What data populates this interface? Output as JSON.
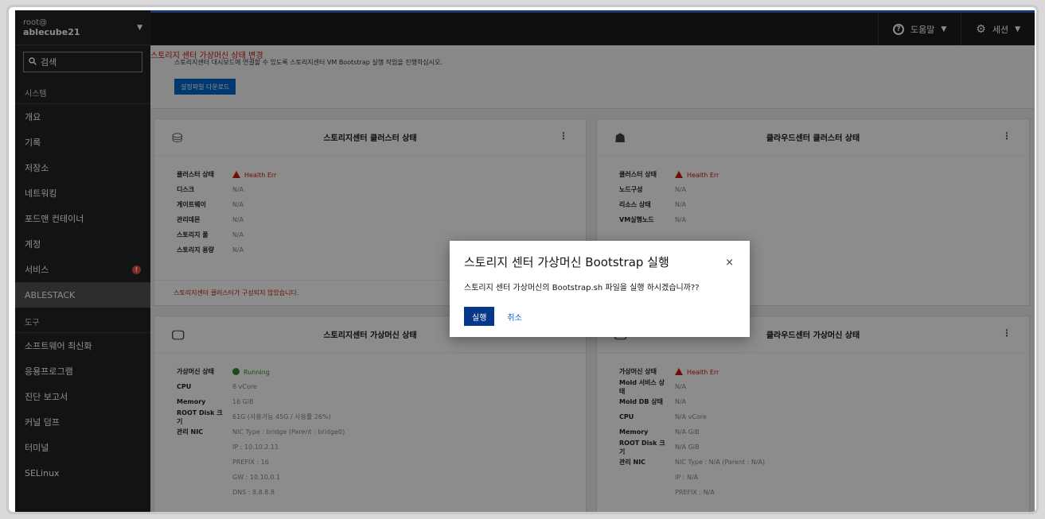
{
  "sidebar": {
    "user_line1": "root@",
    "user_line2": "ablecube21",
    "search_label": "검색",
    "items": [
      {
        "label": "시스템",
        "type": "section"
      },
      {
        "label": "개요"
      },
      {
        "label": "기록"
      },
      {
        "label": "저장소"
      },
      {
        "label": "네트워킹"
      },
      {
        "label": "포드맨 컨테이너"
      },
      {
        "label": "계정"
      },
      {
        "label": "서비스",
        "alert": "!"
      },
      {
        "label": "ABLESTACK",
        "active": true
      },
      {
        "label": "도구",
        "type": "section"
      },
      {
        "label": "소프트웨어 최신화"
      },
      {
        "label": "응용프로그램"
      },
      {
        "label": "진단 보고서"
      },
      {
        "label": "커널 덤프"
      },
      {
        "label": "터미널"
      },
      {
        "label": "SELinux"
      }
    ]
  },
  "topbar": {
    "help_label": "도움말",
    "session_label": "세션"
  },
  "banner": {
    "title": "스토리지 센터 가상머신 상태 변경",
    "desc": "스토리지센터 대시보드에 연결할 수 있도록 스토리지센터 VM Bootstrap 실행 작업을 진행하십시오.",
    "button": "설정파일 다운로드"
  },
  "cards": {
    "storage_cluster": {
      "title": "스토리지센터 클러스터 상태",
      "rows": [
        {
          "k": "클러스터 상태",
          "v": "Health Err"
        },
        {
          "k": "디스크",
          "v": "N/A"
        },
        {
          "k": "게이트웨이",
          "v": "N/A"
        },
        {
          "k": "관리데몬",
          "v": "N/A"
        },
        {
          "k": "스토리지 풀",
          "v": "N/A"
        },
        {
          "k": "스토리지 용량",
          "v": "N/A"
        }
      ],
      "footer": "스토리지센터 클러스터가 구성되지 않았습니다."
    },
    "cloud_cluster": {
      "title": "클라우드센터 클러스터 상태",
      "rows": [
        {
          "k": "클러스터 상태",
          "v": "Health Err"
        },
        {
          "k": "노드구성",
          "v": "N/A"
        },
        {
          "k": "리소스 상태",
          "v": "N/A"
        },
        {
          "k": "VM실행노드",
          "v": "N/A"
        }
      ]
    },
    "storage_vm": {
      "title": "스토리지센터 가상머신 상태",
      "rows": [
        {
          "k": "가상머신 상태",
          "v": "Running"
        },
        {
          "k": "CPU",
          "v": "8 vCore"
        },
        {
          "k": "Memory",
          "v": "16 GiB"
        },
        {
          "k": "ROOT Disk 크기",
          "v": "61G (사용가능 45G / 사용률 26%)"
        },
        {
          "k": "관리 NIC",
          "v": "NIC Type : bridge (Parent : bridge0)"
        },
        {
          "k": "",
          "v": "IP : 10.10.2.11"
        },
        {
          "k": "",
          "v": "PREFIX : 16"
        },
        {
          "k": "",
          "v": "GW : 10.10.0.1"
        },
        {
          "k": "",
          "v": "DNS : 8.8.8.8"
        }
      ]
    },
    "cloud_vm": {
      "title": "클라우드센터 가상머신 상태",
      "rows": [
        {
          "k": "가상머신 상태",
          "v": "Health Err"
        },
        {
          "k": "Mold 서비스 상태",
          "v": "N/A"
        },
        {
          "k": "Mold DB 상태",
          "v": "N/A"
        },
        {
          "k": "CPU",
          "v": "N/A vCore"
        },
        {
          "k": "Memory",
          "v": "N/A GiB"
        },
        {
          "k": "ROOT Disk 크기",
          "v": "N/A GiB"
        },
        {
          "k": "관리 NIC",
          "v": "NIC Type : N/A (Parent : N/A)"
        },
        {
          "k": "",
          "v": "IP : N/A"
        },
        {
          "k": "",
          "v": "PREFIX : N/A"
        }
      ]
    }
  },
  "modal": {
    "title": "스토리지 센터 가상머신 Bootstrap 실행",
    "message": "스토리지 센터 가상머신의 Bootstrap.sh 파일을 실행 하시겠습니까??",
    "confirm": "실행",
    "cancel": "취소",
    "close": "×"
  },
  "colors": {
    "accent": "#06388a",
    "error": "#c9190b",
    "ok": "#3e8635",
    "sidebar_bg": "#212427"
  }
}
